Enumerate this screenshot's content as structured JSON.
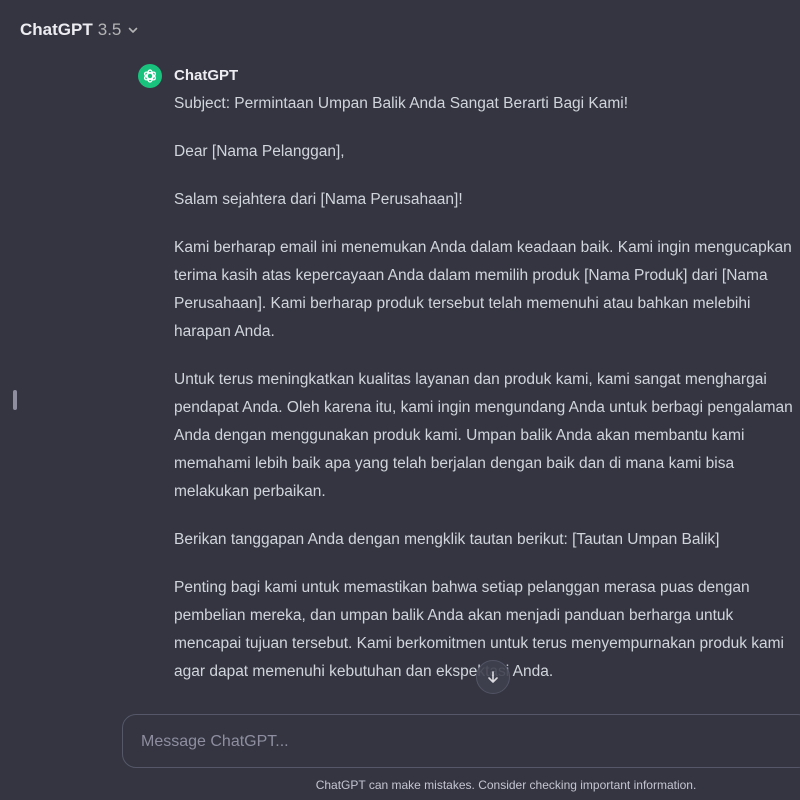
{
  "header": {
    "model_name": "ChatGPT",
    "model_version": "3.5",
    "chevron_icon": "chevron-down-icon"
  },
  "message": {
    "author": "ChatGPT",
    "avatar_icon": "openai-logo-icon",
    "avatar_color": "#19c37d",
    "paragraphs": [
      "Subject: Permintaan Umpan Balik Anda Sangat Berarti Bagi Kami!",
      "Dear [Nama Pelanggan],",
      "Salam sejahtera dari [Nama Perusahaan]!",
      "Kami berharap email ini menemukan Anda dalam keadaan baik. Kami ingin mengucapkan terima kasih atas kepercayaan Anda dalam memilih produk [Nama Produk] dari [Nama Perusahaan]. Kami berharap produk tersebut telah memenuhi atau bahkan melebihi harapan Anda.",
      "Untuk terus meningkatkan kualitas layanan dan produk kami, kami sangat menghargai pendapat Anda. Oleh karena itu, kami ingin mengundang Anda untuk berbagi pengalaman Anda dengan menggunakan produk kami. Umpan balik Anda akan membantu kami memahami lebih baik apa yang telah berjalan dengan baik dan di mana kami bisa melakukan perbaikan.",
      "Berikan tanggapan Anda dengan mengklik tautan berikut: [Tautan Umpan Balik]",
      "Penting bagi kami untuk memastikan bahwa setiap pelanggan merasa puas dengan pembelian mereka, dan umpan balik Anda akan menjadi panduan berharga untuk mencapai tujuan tersebut. Kami berkomitmen untuk terus menyempurnakan produk kami agar dapat memenuhi kebutuhan dan ekspektasi Anda."
    ]
  },
  "scroll_button_icon": "arrow-down-icon",
  "composer": {
    "placeholder": "Message ChatGPT...",
    "value": ""
  },
  "footer_note": "ChatGPT can make mistakes. Consider checking important information.",
  "colors": {
    "background": "#343541",
    "accent": "#19c37d"
  }
}
